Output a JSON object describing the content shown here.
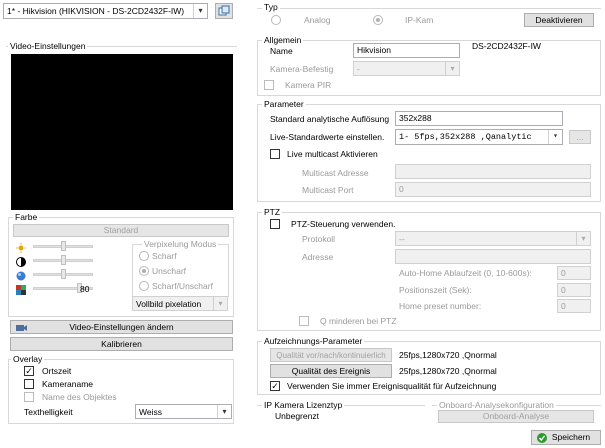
{
  "camera_select": {
    "value": "1* - Hikvision  (HIKVISION - DS-2CD2432F-IW)"
  },
  "video_settings": {
    "title": "Video-Einstellungen",
    "color_group": "Farbe",
    "standard_button": "Standard",
    "sharpness_value": "80",
    "pixelation_group": "Verpixelung Modus",
    "pixel_options": [
      "Scharf",
      "Unscharf",
      "Scharf/Unscharf"
    ],
    "pixel_mode_value": "Vollbild pixelation",
    "change_button": "Video-Einstellungen ändern",
    "calibrate_button": "Kalibrieren"
  },
  "overlay": {
    "title": "Overlay",
    "items": [
      {
        "label": "Ortszeit",
        "checked": true
      },
      {
        "label": "Kameraname",
        "checked": false
      },
      {
        "label": "Name des Objektes",
        "checked": false
      }
    ],
    "brightness_label": "Texthelligkeit",
    "brightness_value": "Weiss"
  },
  "typ": {
    "title": "Typ",
    "analog_label": "Analog",
    "ipcam_label": "IP-Kam",
    "deactivate_button": "Deaktivieren"
  },
  "allgemein": {
    "title": "Allgemein",
    "name_label": "Name",
    "name_value": "Hikvision",
    "model": "DS-2CD2432F-IW",
    "mount_label": "Kamera-Befestig",
    "mount_value": "-",
    "pir_label": "Kamera PIR"
  },
  "parameter": {
    "title": "Parameter",
    "res_label": "Standard analytische Auflösung",
    "res_value": "352x288",
    "live_label": "Live-Standardwerte einstellen.",
    "live_value": "1- 5fps,352x288  ,Qanalytic",
    "more_button": "...",
    "multicast_label": "Live multicast Aktivieren",
    "mc_address_label": "Multicast Adresse",
    "mc_address_value": "",
    "mc_port_label": "Multicast Port",
    "mc_port_value": "0"
  },
  "ptz": {
    "title": "PTZ",
    "use_label": "PTZ-Steuerung verwenden.",
    "protocol_label": "Protokoll",
    "protocol_value": "--",
    "address_label": "Adresse",
    "address_value": "",
    "autohome_label": "Auto-Home Ablaufzeit (0, 10-600s):",
    "autohome_value": "0",
    "position_label": "Positionszeit (Sek):",
    "position_value": "0",
    "preset_label": "Home preset number:",
    "preset_value": "0",
    "q_label": "Q minderen bei PTZ"
  },
  "recording": {
    "title": "Aufzeichnungs-Parameter",
    "quality_button": "Qualität vor/nach/kontinuierlich",
    "quality_value": "25fps,1280x720 ,Qnormal",
    "event_button": "Qualität des Ereignis",
    "event_value": "25fps,1280x720 ,Qnormal",
    "always_label": "Verwenden Sie immer Ereignisqualität für Aufzeichnung"
  },
  "license": {
    "title": "IP Kamera Lizenztyp",
    "value": "Unbegrenzt"
  },
  "onboard": {
    "title": "Onboard-Analysekonfiguration",
    "button": "Onboard-Analyse"
  },
  "save_button": "Speichern",
  "colors": {
    "save_icon": "#2e9a2e",
    "video_bg": "#000000"
  }
}
